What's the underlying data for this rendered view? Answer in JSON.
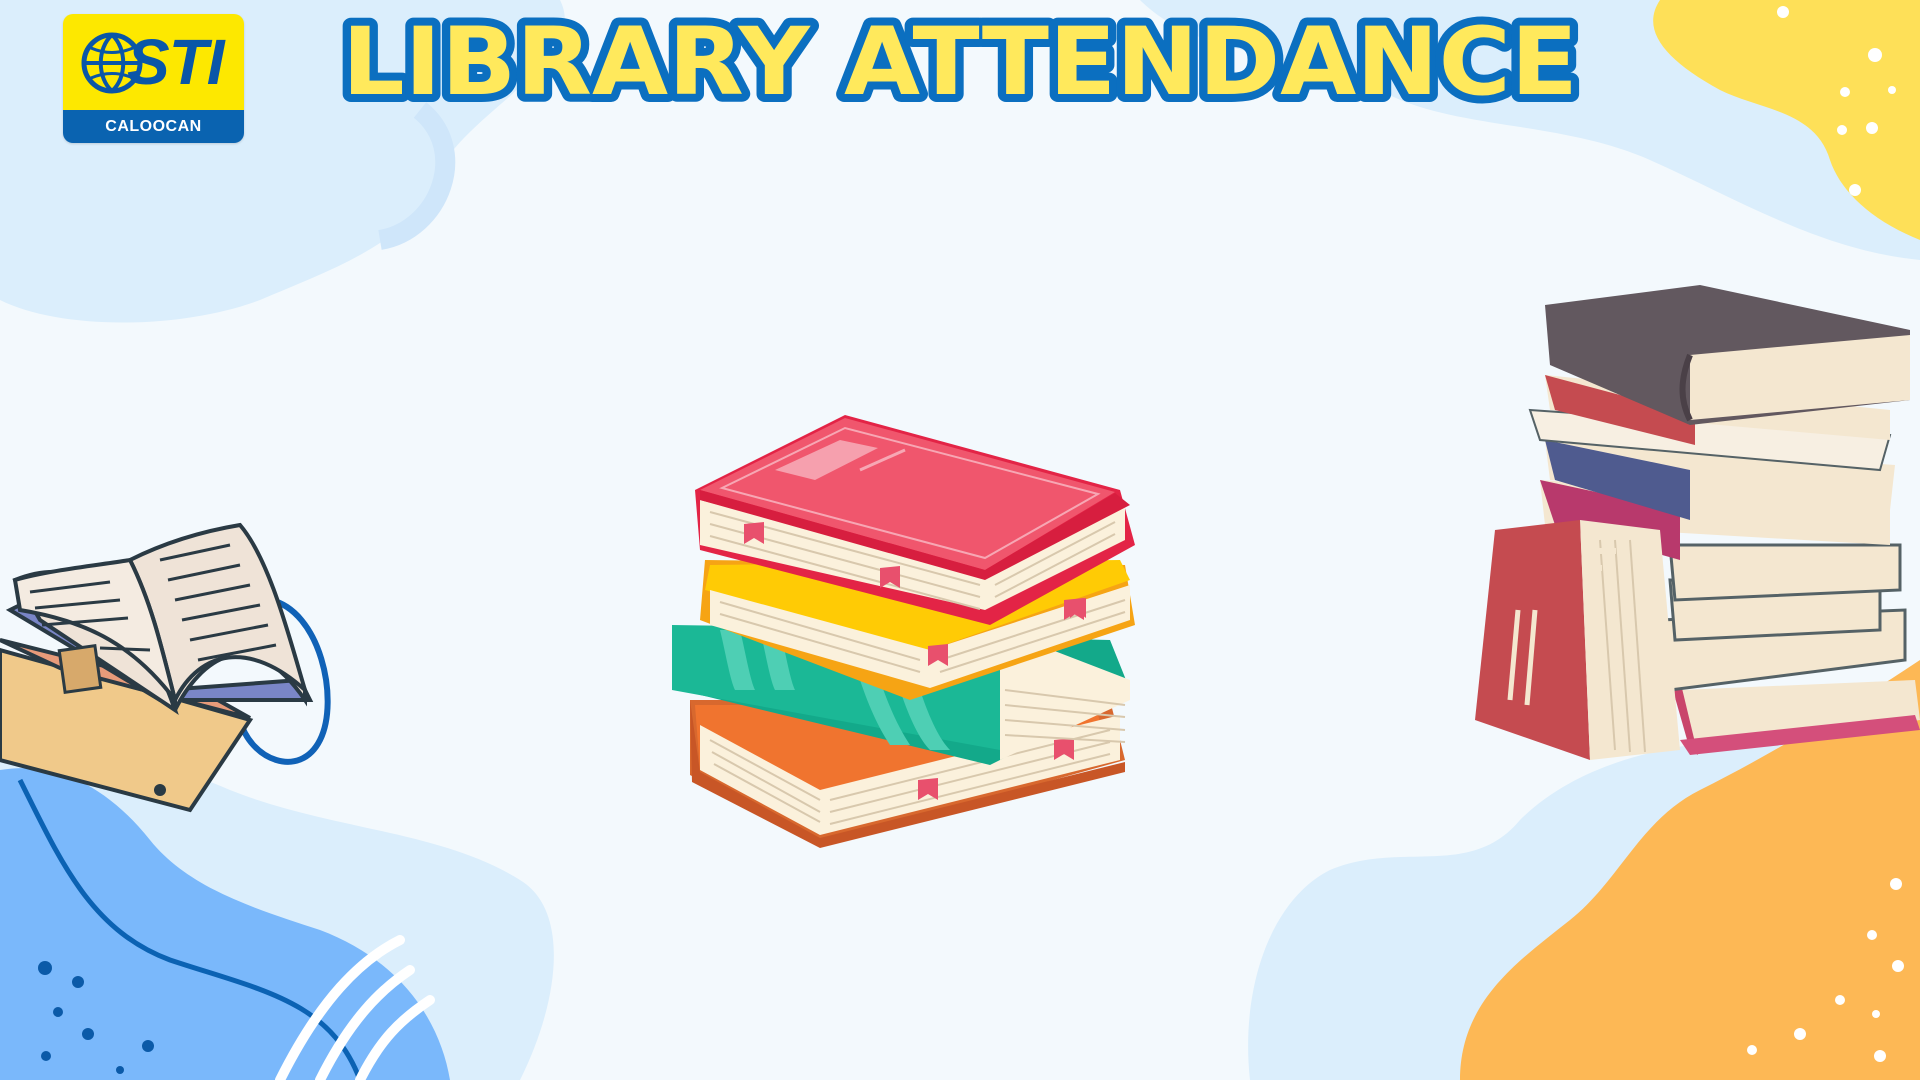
{
  "page": {
    "title": "LIBRARY ATTENDANCE"
  },
  "logo": {
    "brand": "STI",
    "campus": "CALOOCAN"
  },
  "colors": {
    "background": "#f3f9fd",
    "blob_light": "#dbeefc",
    "blob_blue": "#7ab8fb",
    "blob_yellow": "#fee058",
    "blob_orange": "#fdb855",
    "title_fill": "#ffe95c",
    "title_outline": "#0b6fc0",
    "logo_yellow": "#fde800",
    "logo_blue": "#0a63b0"
  },
  "illustrations": {
    "center": "stacked-books-illustration",
    "left": "open-book-illustration",
    "right": "book-pile-illustration"
  }
}
